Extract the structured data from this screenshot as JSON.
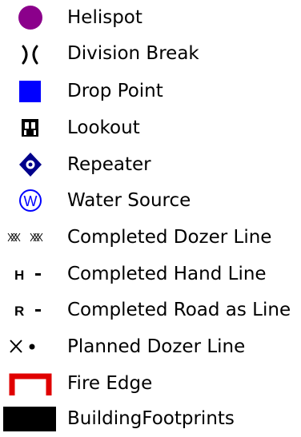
{
  "legend": {
    "items": [
      {
        "label": "Helispot",
        "icon": "helispot-icon",
        "color": "#8b008b"
      },
      {
        "label": "Division Break",
        "icon": "division-break-icon",
        "color": "#000000"
      },
      {
        "label": "Drop Point",
        "icon": "drop-point-icon",
        "color": "#0000ff"
      },
      {
        "label": "Lookout",
        "icon": "lookout-icon",
        "color": "#000000"
      },
      {
        "label": "Repeater",
        "icon": "repeater-icon",
        "color": "#00008b"
      },
      {
        "label": "Water Source",
        "icon": "water-source-icon",
        "color": "#0000ff",
        "glyph": "W"
      },
      {
        "label": "Completed Dozer Line",
        "icon": "completed-dozer-line-icon",
        "color": "#000000"
      },
      {
        "label": "Completed Hand Line",
        "icon": "completed-hand-line-icon",
        "color": "#000000",
        "glyph": "H"
      },
      {
        "label": "Completed Road as Line",
        "icon": "completed-road-line-icon",
        "color": "#000000",
        "glyph": "R"
      },
      {
        "label": "Planned Dozer Line",
        "icon": "planned-dozer-line-icon",
        "color": "#000000"
      },
      {
        "label": "Fire Edge",
        "icon": "fire-edge-icon",
        "color": "#e00000"
      },
      {
        "label": "BuildingFootprints",
        "icon": "building-footprint-icon",
        "color": "#000000"
      }
    ]
  }
}
